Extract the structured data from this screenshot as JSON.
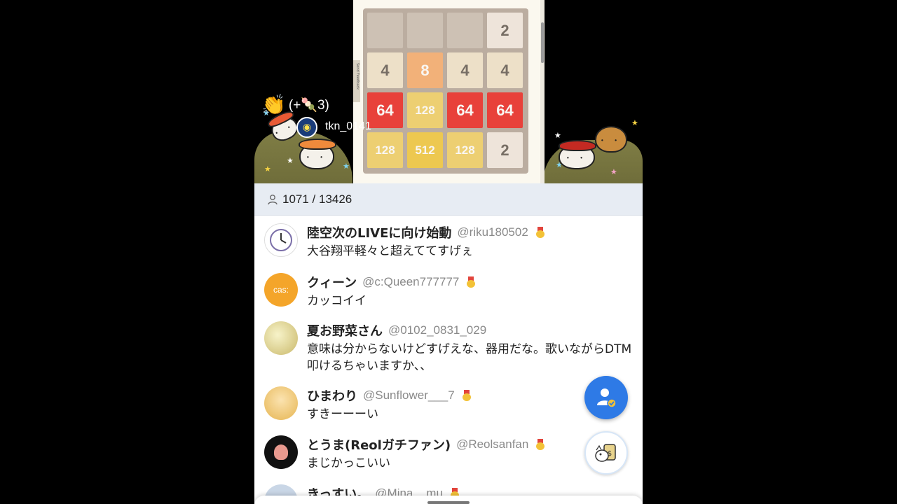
{
  "donation": {
    "icon": "clap-icon",
    "text": "(+🍡3)"
  },
  "viewer": {
    "name": "tkn_0141"
  },
  "game": {
    "feedback_label": "Send Feedback",
    "tiles": [
      {
        "value": "",
        "bg": "#cdc1b4",
        "color": "#776e65"
      },
      {
        "value": "",
        "bg": "#cdc1b4",
        "color": "#776e65"
      },
      {
        "value": "",
        "bg": "#cdc1b4",
        "color": "#776e65"
      },
      {
        "value": "2",
        "bg": "#eee4da",
        "color": "#776e65"
      },
      {
        "value": "4",
        "bg": "#ede0c8",
        "color": "#776e65"
      },
      {
        "value": "8",
        "bg": "#f2b179",
        "color": "#f9f6f2"
      },
      {
        "value": "4",
        "bg": "#ede0c8",
        "color": "#776e65"
      },
      {
        "value": "4",
        "bg": "#ede0c8",
        "color": "#776e65"
      },
      {
        "value": "64",
        "bg": "#e8413a",
        "color": "#f9f6f2"
      },
      {
        "value": "128",
        "bg": "#edcf72",
        "color": "#f9f6f2"
      },
      {
        "value": "64",
        "bg": "#e8413a",
        "color": "#f9f6f2"
      },
      {
        "value": "64",
        "bg": "#e8413a",
        "color": "#f9f6f2"
      },
      {
        "value": "128",
        "bg": "#edcf72",
        "color": "#f9f6f2"
      },
      {
        "value": "512",
        "bg": "#edc850",
        "color": "#f9f6f2"
      },
      {
        "value": "128",
        "bg": "#edcf72",
        "color": "#f9f6f2"
      },
      {
        "value": "2",
        "bg": "#eee4da",
        "color": "#776e65"
      }
    ]
  },
  "header": {
    "count_text": "1071 / 13426",
    "icon": "person-icon"
  },
  "comments": [
    {
      "name": "陸空次のLIVEに向け始動",
      "handle": "@riku180502",
      "badge": true,
      "text": "大谷翔平軽々と超えててすげぇ",
      "avatar": "clock-avatar"
    },
    {
      "name": "クィーン",
      "handle": "@c:Queen777777",
      "badge": true,
      "text": "カッコイイ",
      "avatar": "cat-avatar",
      "avatar_text": "cas:"
    },
    {
      "name": "夏お野菜さん",
      "handle": "@0102_0831_029",
      "badge": false,
      "text": "意味は分からないけどすげえな、器用だな。歌いながらDTM叩けるちゃいますか、、",
      "avatar": "room-avatar"
    },
    {
      "name": "ひまわり",
      "handle": "@Sunflower___7",
      "badge": true,
      "text": "すきーーーい",
      "avatar": "girl-avatar"
    },
    {
      "name": "とうま(Reolガチファン)",
      "handle": "@Reolsanfan",
      "badge": true,
      "text": "まじかっこいい",
      "avatar": "character-avatar"
    },
    {
      "name": "きっすい。",
      "handle": "@Mina__mu",
      "badge": true,
      "text": "",
      "avatar": "mina-avatar"
    }
  ],
  "buttons": {
    "follow": "follow-button",
    "sticker": "sticker-button"
  },
  "colors": {
    "accent": "#2e7ae6",
    "header_bg": "#e7ecf3"
  }
}
